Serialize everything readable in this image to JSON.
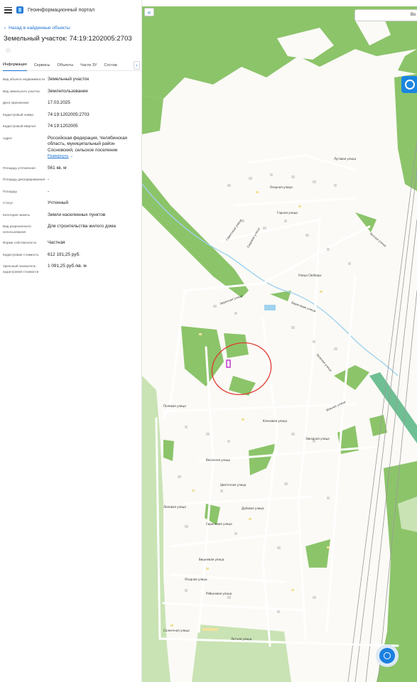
{
  "header": {
    "title": "Геоинформационный портал"
  },
  "nav": {
    "back_label": "Назад в найденные объекты"
  },
  "object": {
    "title": "Земельный участок: 74:19:1202005:2703"
  },
  "tabs": [
    {
      "label": "Информация",
      "active": true
    },
    {
      "label": "Сервисы",
      "active": false
    },
    {
      "label": "Объекты",
      "active": false
    },
    {
      "label": "Части ЗУ",
      "active": false
    },
    {
      "label": "Состав",
      "active": false
    }
  ],
  "properties": [
    {
      "label": "Вид объекта недвижимости",
      "value": "Земельный участок"
    },
    {
      "label": "Вид земельного участка",
      "value": "Землепользование"
    },
    {
      "label": "Дата присвоения",
      "value": "17.03.2025"
    },
    {
      "label": "Кадастровый номер",
      "value": "74:19:1202005:2703"
    },
    {
      "label": "Кадастровый квартал",
      "value": "74:19:1202005"
    },
    {
      "label": "Адрес",
      "value": "Российская федерация, Челябинская область, муниципальный район Сосновский, сельское поселение",
      "link": "Развернуть"
    },
    {
      "label": "Площадь уточненная",
      "value": "561 кв. м"
    },
    {
      "label": "Площадь декларированная",
      "value": "-"
    },
    {
      "label": "Площадь",
      "value": "-"
    },
    {
      "label": "Статус",
      "value": "Учтенный"
    },
    {
      "label": "Категория земель",
      "value": "Земли населенных пунктов"
    },
    {
      "label": "Вид разрешенного использования",
      "value": "Для строительства жилого дома"
    },
    {
      "label": "Форма собственности",
      "value": "Частная"
    },
    {
      "label": "Кадастровая стоимость",
      "value": "612 191,25 руб."
    },
    {
      "label": "Удельный показатель кадастровой стоимости",
      "value": "1 091,25 руб./кв. м"
    }
  ],
  "map": {
    "search_placeholder": "Во",
    "colors": {
      "background": "#fbfaf6",
      "forest": "#8cc46a",
      "forest_light": "#c9e3b4",
      "river": "#9fd2ef",
      "road": "#ffffff",
      "railway": "#9a9a9a",
      "building": "#d8d8d8",
      "building_yellow": "#f1e29b",
      "highlight_circle": "#e0392f",
      "parcel": "#c23bd1"
    },
    "streets": [
      "Луговая улица",
      "Озерная улица",
      "Горная улица",
      "Садовая улица",
      "Лесная улица",
      "Улица Свободы",
      "Советская улица",
      "Береговая улица",
      "Заречная улица",
      "Зеленая улица",
      "Кленовая улица",
      "Цветочная улица",
      "Дубовая улица",
      "Сиреневая улица",
      "Липовая улица",
      "Вишневая улица",
      "Ягодная улица",
      "Рябиновая улица",
      "Солнечная улица",
      "Летняя улица",
      "Полевая улица",
      "Весенняя улица",
      "Звездная улица",
      "Южная улица"
    ]
  }
}
